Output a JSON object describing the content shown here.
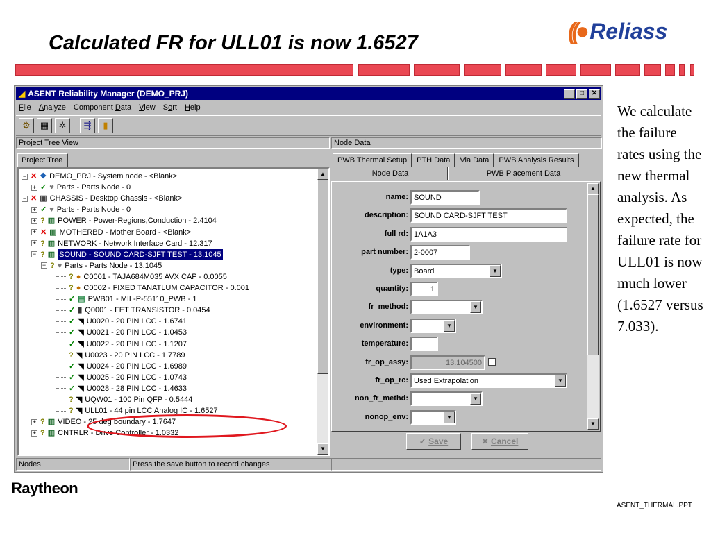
{
  "slide": {
    "title": "Calculated FR for ULL01 is now 1.6527",
    "logo_text": "Reliass",
    "side_text": "We calculate the failure rates using the new thermal analysis. As expected, the failure rate for ULL01 is now much lower (1.6527 versus 7.033).",
    "footer_brand": "Raytheon",
    "footer_file": "ASENT_THERMAL.PPT",
    "accent_color": "#ea4853",
    "ring_color": "#e0181f"
  },
  "window": {
    "title": "ASENT Reliability Manager (DEMO_PRJ)",
    "menu": [
      "File",
      "Analyze",
      "Component Data",
      "View",
      "Sort",
      "Help"
    ],
    "toolbar_icons": [
      "parts-icon",
      "calculator-icon",
      "gear-icon",
      "report-icon",
      "exit-icon"
    ]
  },
  "left_panel": {
    "header": "Project Tree View",
    "tab": "Project Tree",
    "tree": [
      {
        "status": "x",
        "icon": "system",
        "text": "DEMO_PRJ  -  System node  -  <Blank>"
      },
      {
        "status": "ok",
        "icon": "node",
        "text": "Parts  -  Parts Node  -  0"
      },
      {
        "status": "x",
        "icon": "chassis",
        "text": "CHASSIS  -  Desktop Chassis  -  <Blank>"
      },
      {
        "status": "ok",
        "icon": "node",
        "text": "Parts  -  Parts Node  -  0"
      },
      {
        "status": "q",
        "icon": "board",
        "text": "POWER  -  Power-Regions,Conduction  -  2.4104"
      },
      {
        "status": "x",
        "icon": "board",
        "text": "MOTHERBD  -  Mother Board  -  <Blank>"
      },
      {
        "status": "q",
        "icon": "board",
        "text": "NETWORK  -  Network Interface Card  -  12.317"
      },
      {
        "status": "q",
        "icon": "board",
        "text": "SOUND  -  SOUND CARD-SJFT TEST  -  13.1045"
      },
      {
        "status": "q",
        "icon": "node",
        "text": "Parts  -  Parts Node  -  13.1045"
      },
      {
        "status": "q",
        "icon": "cap",
        "text": "C0001  -  TAJA684M035 AVX  CAP  -  0.0055"
      },
      {
        "status": "q",
        "icon": "cap",
        "text": "C0002  -  FIXED TANATLUM CAPACITOR  -  0.001"
      },
      {
        "status": "ok",
        "icon": "pwb",
        "text": "PWB01  -  MIL-P-55110_PWB  -  1"
      },
      {
        "status": "ok",
        "icon": "transistor",
        "text": "Q0001  -  FET TRANSISTOR  -  0.0454"
      },
      {
        "status": "ok",
        "icon": "chip",
        "text": "U0020  -  20 PIN LCC  -  1.6741"
      },
      {
        "status": "ok",
        "icon": "chip",
        "text": "U0021  -  20 PIN LCC  -  1.0453"
      },
      {
        "status": "ok",
        "icon": "chip",
        "text": "U0022  -  20 PIN LCC  -  1.1207"
      },
      {
        "status": "q",
        "icon": "chip",
        "text": "U0023  -  20 PIN LCC  -  1.7789"
      },
      {
        "status": "ok",
        "icon": "chip",
        "text": "U0024  -  20 PIN LCC  -  1.6989"
      },
      {
        "status": "ok",
        "icon": "chip",
        "text": "U0025  -  20 PIN LCC  -  1.0743"
      },
      {
        "status": "ok",
        "icon": "chip",
        "text": "U0028  -  28 PIN LCC  -  1.4633"
      },
      {
        "status": "q",
        "icon": "chip",
        "text": "UQW01  -  100 Pin QFP  -  0.5444"
      },
      {
        "status": "q",
        "icon": "chip",
        "text": "ULL01  -  44 pin LCC Analog IC  -  1.6527"
      },
      {
        "status": "q",
        "icon": "board",
        "text": "VIDEO  -  25 deg boundary  -  1.7647"
      },
      {
        "status": "q",
        "icon": "board",
        "text": "CNTRLR  -  Drive Controller  -  1.0332"
      }
    ],
    "selected_index": 7
  },
  "right_panel": {
    "header": "Node Data",
    "tabs_top": [
      "PWB Thermal Setup",
      "PTH Data",
      "Via Data",
      "PWB Analysis Results"
    ],
    "tabs_bottom": [
      "Node Data",
      "PWB Placement Data"
    ],
    "fields": [
      {
        "label": "name:",
        "value": "SOUND",
        "kind": "text"
      },
      {
        "label": "description:",
        "value": "SOUND CARD-SJFT TEST",
        "kind": "text"
      },
      {
        "label": "full rd:",
        "value": "1A1A3",
        "kind": "text"
      },
      {
        "label": "part number:",
        "value": "2-0007",
        "kind": "text"
      },
      {
        "label": "type:",
        "value": "Board",
        "kind": "select"
      },
      {
        "label": "quantity:",
        "value": "1",
        "kind": "number"
      },
      {
        "label": "fr_method:",
        "value": "",
        "kind": "select"
      },
      {
        "label": "environment:",
        "value": "",
        "kind": "select"
      },
      {
        "label": "temperature:",
        "value": "",
        "kind": "text"
      },
      {
        "label": "fr_op_assy:",
        "value": "13.104500",
        "kind": "disabled"
      },
      {
        "label": "fr_op_rc:",
        "value": "Used Extrapolation",
        "kind": "select"
      },
      {
        "label": "non_fr_methd:",
        "value": "",
        "kind": "select"
      },
      {
        "label": "nonop_env:",
        "value": "",
        "kind": "select"
      }
    ],
    "save_label": "Save",
    "cancel_label": "Cancel"
  },
  "status": {
    "left": "Nodes",
    "message": "Press the save button to record changes"
  }
}
